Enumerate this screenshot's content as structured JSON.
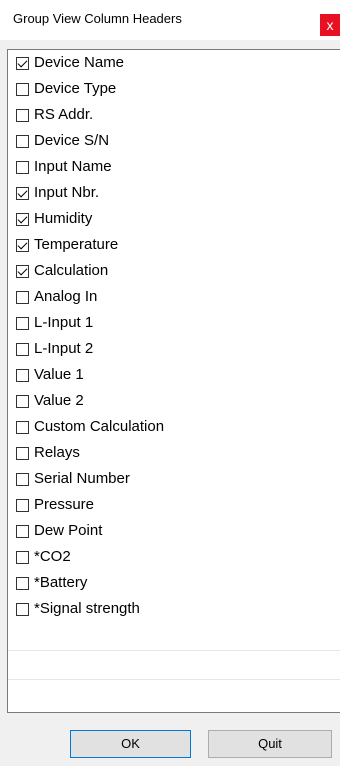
{
  "window": {
    "title": "Group View Column Headers",
    "close_label": "x"
  },
  "columns": [
    {
      "label": "Device Name",
      "checked": true
    },
    {
      "label": "Device Type",
      "checked": false
    },
    {
      "label": "RS Addr.",
      "checked": false
    },
    {
      "label": "Device S/N",
      "checked": false
    },
    {
      "label": "Input Name",
      "checked": false
    },
    {
      "label": "Input Nbr.",
      "checked": true
    },
    {
      "label": "Humidity",
      "checked": true
    },
    {
      "label": "Temperature",
      "checked": true
    },
    {
      "label": "Calculation",
      "checked": true
    },
    {
      "label": "Analog In",
      "checked": false
    },
    {
      "label": "L-Input 1",
      "checked": false
    },
    {
      "label": "L-Input 2",
      "checked": false
    },
    {
      "label": "Value 1",
      "checked": false
    },
    {
      "label": "Value 2",
      "checked": false
    },
    {
      "label": "Custom Calculation",
      "checked": false
    },
    {
      "label": "Relays",
      "checked": false
    },
    {
      "label": "Serial Number",
      "checked": false
    },
    {
      "label": "Pressure",
      "checked": false
    },
    {
      "label": "Dew Point",
      "checked": false
    },
    {
      "label": "*CO2",
      "checked": false
    },
    {
      "label": "*Battery",
      "checked": false
    },
    {
      "label": "*Signal strength",
      "checked": false
    }
  ],
  "buttons": {
    "ok_label": "OK",
    "quit_label": "Quit"
  },
  "colors": {
    "close_button": "#e81123",
    "ok_border": "#0078d7",
    "button_bg": "#e1e1e1"
  }
}
